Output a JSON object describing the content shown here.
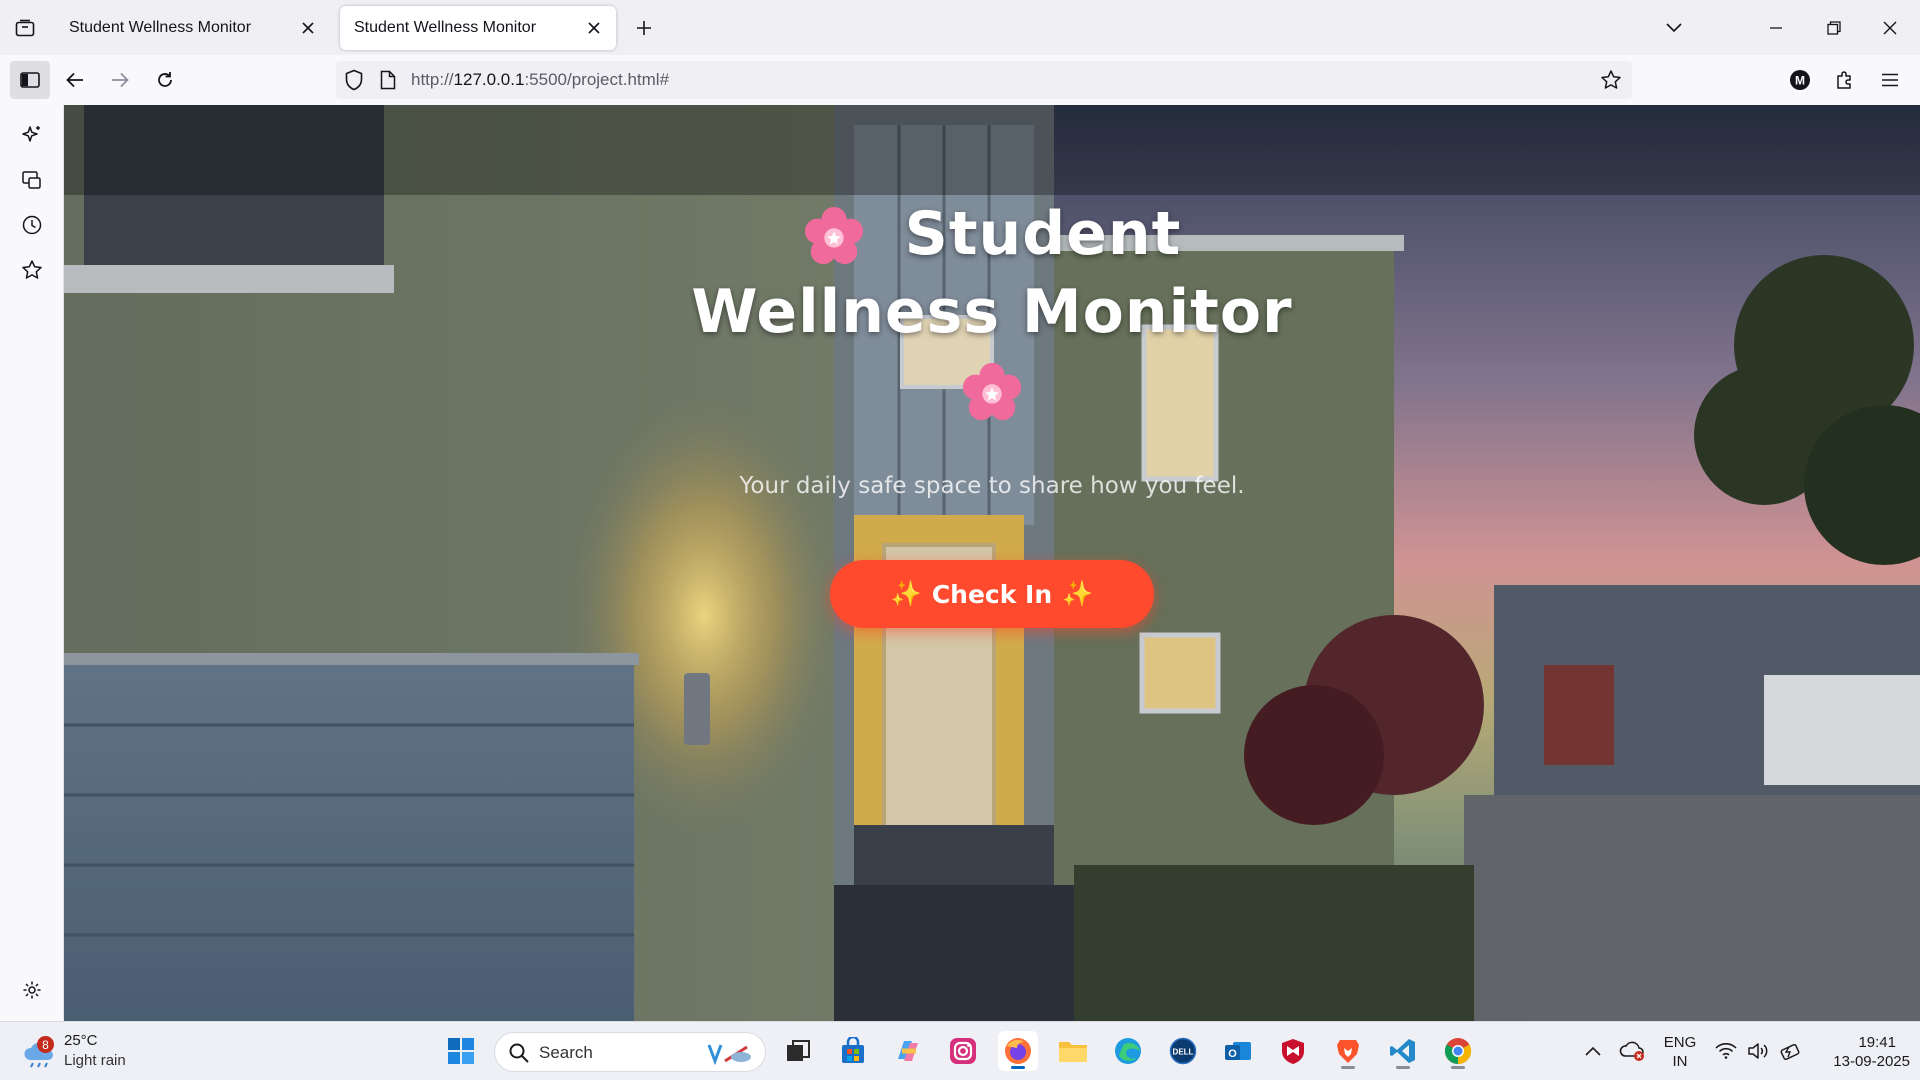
{
  "browser": {
    "tabs": [
      {
        "title": "Student Wellness Monitor",
        "active": false
      },
      {
        "title": "Student Wellness Monitor",
        "active": true
      }
    ],
    "url_prefix": "http://",
    "url_host": "127.0.0.1",
    "url_rest": ":5500/project.html#"
  },
  "page": {
    "title_line1": "Student",
    "title_line2": "Wellness Monitor",
    "subtitle": "Your daily safe space to share how you feel.",
    "checkin_label": "Check In",
    "button_color": "#ff4a2e"
  },
  "taskbar": {
    "weather_badge": "8",
    "weather_temp": "25°C",
    "weather_condition": "Light rain",
    "search_label": "Search",
    "language_line1": "ENG",
    "language_line2": "IN",
    "time": "19:41",
    "date": "13-09-2025"
  }
}
